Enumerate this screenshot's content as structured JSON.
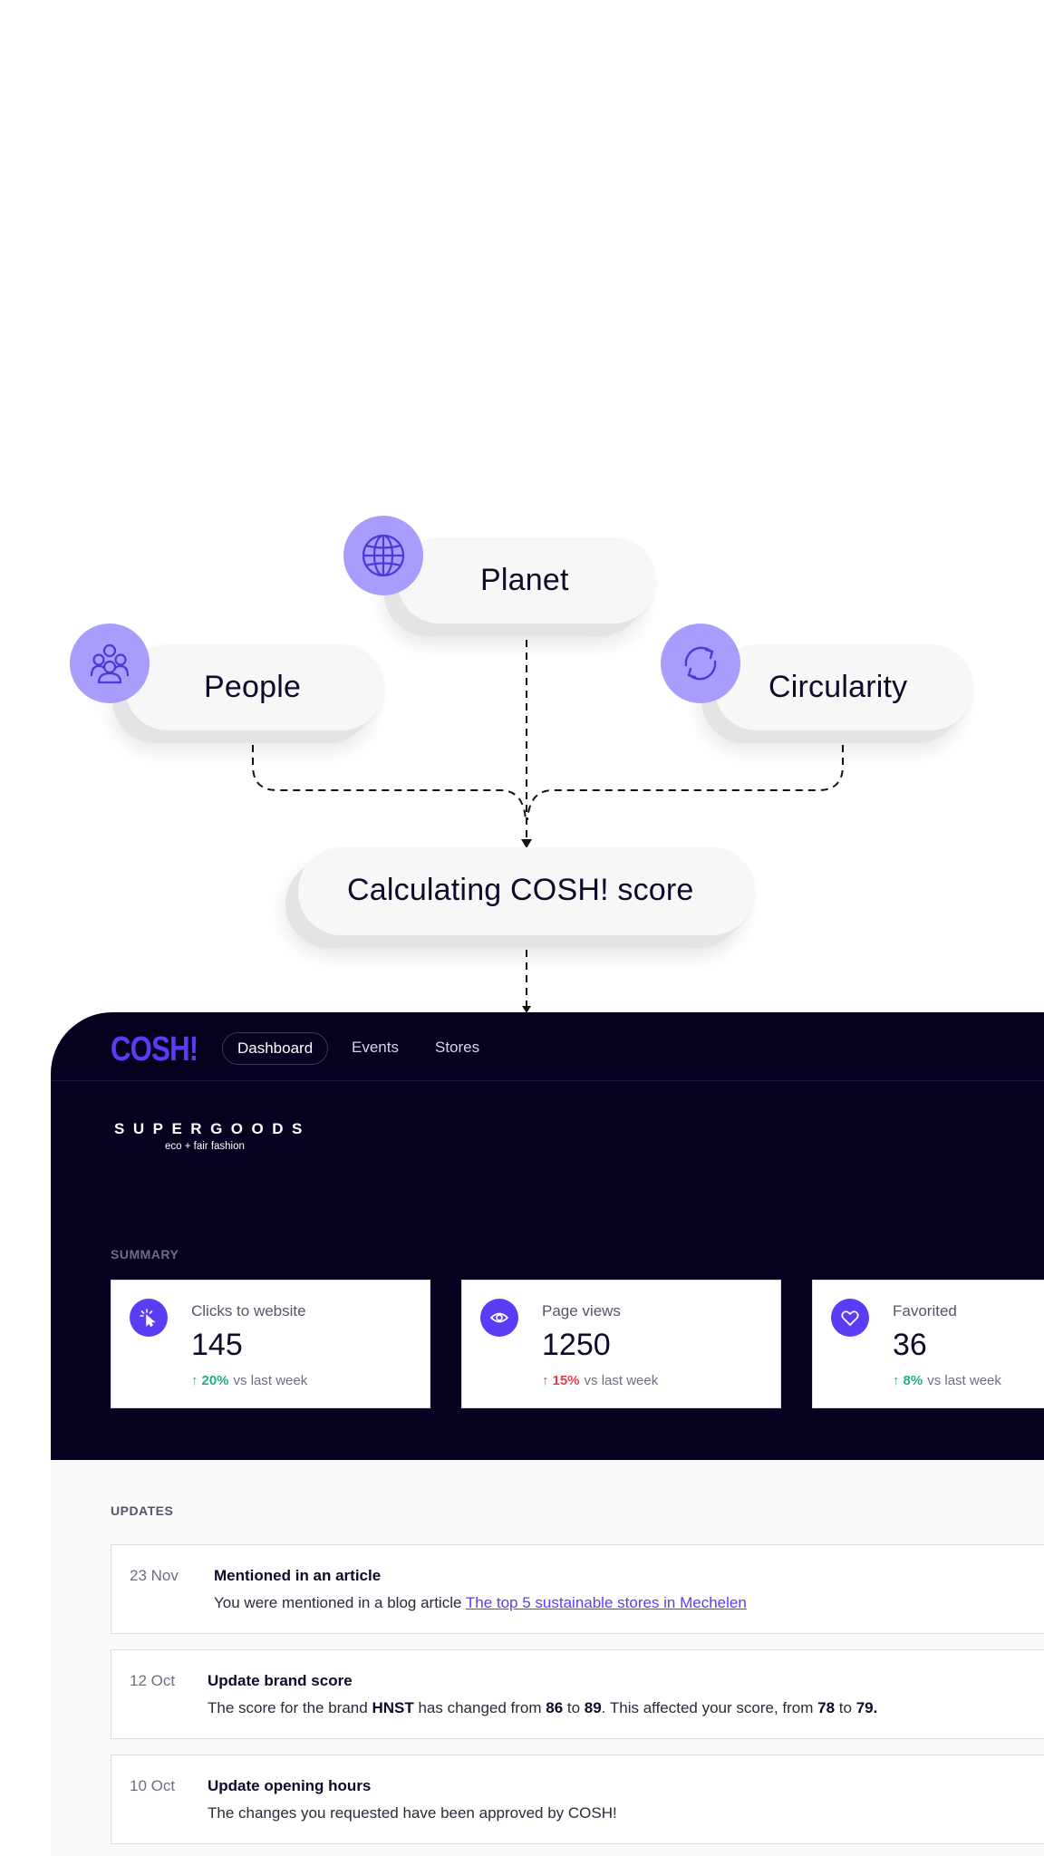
{
  "diagram": {
    "planet": "Planet",
    "people": "People",
    "circularity": "Circularity",
    "score": "Calculating COSH! score"
  },
  "colors": {
    "accent": "#5b3cf5",
    "badge": "#a89dfc",
    "dark_bg": "#05011f",
    "positive": "#21b07a",
    "negative": "#e23d4b"
  },
  "dashboard": {
    "logo": "COSH!",
    "nav": {
      "tabs": [
        "Dashboard",
        "Events",
        "Stores"
      ],
      "active": "Dashboard"
    },
    "store": {
      "name": "SUPERGOODS",
      "tagline": "eco + fair fashion"
    },
    "summary": {
      "label": "SUMMARY",
      "cards": [
        {
          "icon": "cursor-click-icon",
          "label": "Clicks to website",
          "value": "145",
          "change": "20%",
          "direction": "up",
          "color": "green",
          "suffix": "vs last week"
        },
        {
          "icon": "eye-icon",
          "label": "Page views",
          "value": "1250",
          "change": "15%",
          "direction": "up",
          "color": "red",
          "suffix": "vs last week"
        },
        {
          "icon": "heart-icon",
          "label": "Favorited",
          "value": "36",
          "change": "8%",
          "direction": "up",
          "color": "green",
          "suffix": "vs last week"
        }
      ]
    },
    "updates": {
      "label": "UPDATES",
      "items": [
        {
          "date": "23 Nov",
          "title": "Mentioned in an article",
          "body_prefix": "You were mentioned in a blog article ",
          "link": "The top 5 sustainable stores in Mechelen"
        },
        {
          "date": "12 Oct",
          "title": "Update brand score",
          "body": {
            "t1": "The score for the brand ",
            "brand": "HNST",
            "t2": " has changed from ",
            "from": "86",
            "t3": " to ",
            "to": "89",
            "t4": ". This affected your score, from ",
            "score_from": "78",
            "t5": " to ",
            "score_to": "79."
          }
        },
        {
          "date": "10 Oct",
          "title": "Update opening hours",
          "body": "The changes you requested have been approved by COSH!"
        }
      ]
    }
  }
}
